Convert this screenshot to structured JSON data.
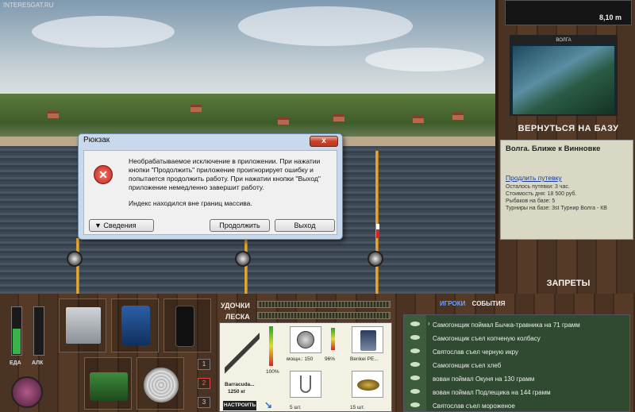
{
  "watermark": "INTERESGAT.RU",
  "depth": "8,10 m",
  "map_card": {
    "title": "ВОЛГА"
  },
  "return_label": "ВЕРНУТЬСЯ НА БАЗУ",
  "location": {
    "title": "Волга. Ближе к Винновке",
    "extend_link": "Продлить путевку",
    "lines": [
      "Осталось путевки: 3 час.",
      "Стоимость дня: 18 500 руб.",
      "Рыбаков на базе: 5",
      "Турниры на базе: 3st Турнир Волга - КВ"
    ]
  },
  "bans_label": "ЗАПРЕТЫ",
  "dialog": {
    "title": "Рюкзак",
    "close": "x",
    "message1": "Необрабатываемое исключение в приложении. При нажатии кнопки \"Продолжить\" приложение проигнорирует ошибку и попытается продолжить работу. При нажатии кнопки \"Выход\" приложение немедленно завершит работу.",
    "message2": "Индекс находился вне границ массива.",
    "details": "▼ Сведения",
    "continue": "Продолжить",
    "exit": "Выход"
  },
  "status": {
    "food_label": "ЕДА",
    "alc_label": "АЛК",
    "food": 0.55,
    "alc": 0.0
  },
  "pages": [
    "1",
    "2",
    "3"
  ],
  "tackle": {
    "rod_label": "УДОЧКИ",
    "line_label": "ЛЕСКА",
    "rod_name": "Barracuda...",
    "rod_weight": "1250 кг",
    "power": "100%",
    "reel_caption": "мощн.: 150",
    "reel_pct": "96%",
    "line_name": "Benkei PE...",
    "hook_count": "5 шт.",
    "bait_count": "15 шт.",
    "set_button": "НАСТРОИТЬ"
  },
  "tabs": {
    "players": "ИГРОКИ",
    "events": "СОБЫТИЯ"
  },
  "events": [
    "Самогонщик поймал Бычка-травника на 71 грамм",
    "Самогонщик съел копченую колбасу",
    "Святослав съел черную икру",
    "Самогонщик съел хлеб",
    "вован поймал Окуня на 130 грамм",
    "вован поймал Подлещика на 144 грамм",
    "Святослав съел мороженое"
  ],
  "colors": {
    "accent_red": "#c9432b",
    "link_blue": "#1a3c9c",
    "tab_active": "#6aa0ff"
  }
}
